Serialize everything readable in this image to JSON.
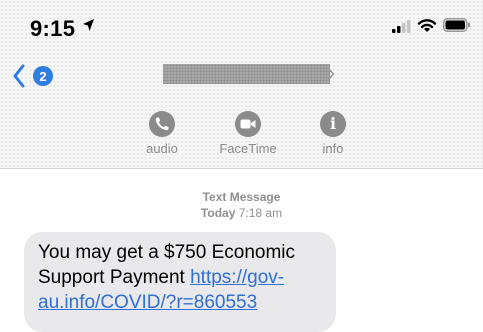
{
  "status_bar": {
    "time": "9:15"
  },
  "nav": {
    "back_badge": "2"
  },
  "actions": [
    {
      "label": "audio",
      "icon": "phone-icon"
    },
    {
      "label": "FaceTime",
      "icon": "video-camera-icon"
    },
    {
      "label": "info",
      "icon": "info-icon"
    }
  ],
  "thread": {
    "type_label": "Text Message",
    "day": "Today",
    "time": "7:18 am"
  },
  "message": {
    "text_line1": "You may get a $750 Economic",
    "text_line2": "Support Payment ",
    "link_part1": "https://gov-",
    "link_part2": "au.info/COVID/?r=860553"
  },
  "colors": {
    "accent": "#2f7de1",
    "bubble": "#e9e9eb",
    "link": "#2f6fd6"
  }
}
